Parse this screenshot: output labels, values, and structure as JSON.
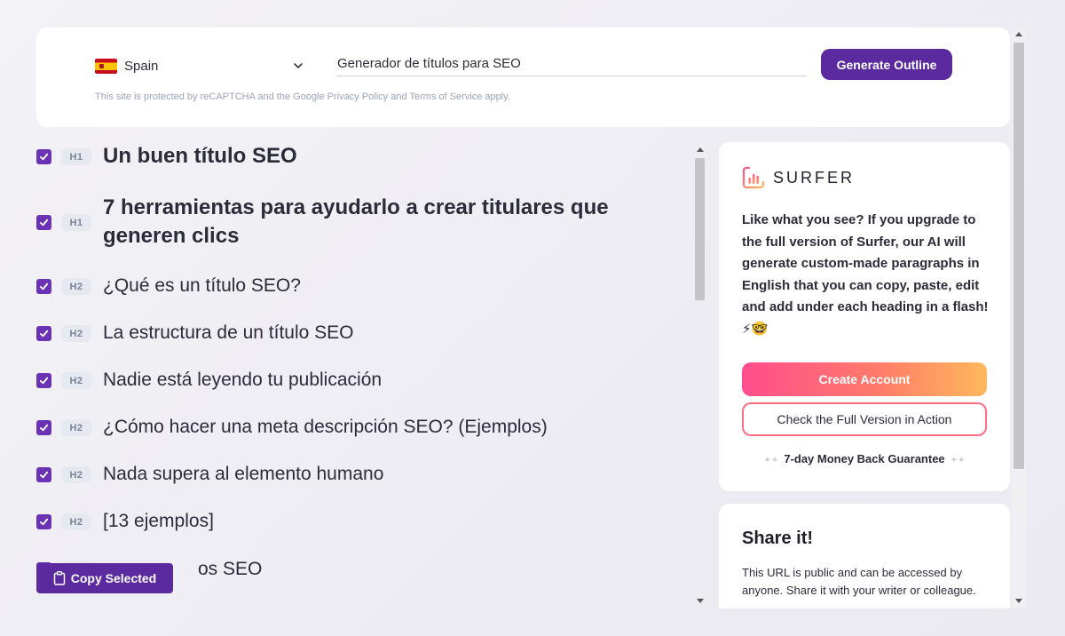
{
  "search": {
    "country": "Spain",
    "topic_value": "Generador de títulos para SEO",
    "generate_label": "Generate Outline",
    "recaptcha_notice": "This site is protected by reCAPTCHA and the Google Privacy Policy and Terms of Service apply."
  },
  "outline": {
    "items": [
      {
        "level": "H1",
        "text": "Un buen título SEO",
        "checked": true
      },
      {
        "level": "H1",
        "text": "7 herramientas para ayudarlo a crear titulares que generen clics",
        "checked": true
      },
      {
        "level": "H2",
        "text": "¿Qué es un título SEO?",
        "checked": true
      },
      {
        "level": "H2",
        "text": "La estructura de un título SEO",
        "checked": true
      },
      {
        "level": "H2",
        "text": "Nadie está leyendo tu publicación",
        "checked": true
      },
      {
        "level": "H2",
        "text": "¿Cómo hacer una meta descripción SEO? (Ejemplos)",
        "checked": true
      },
      {
        "level": "H2",
        "text": "Nada supera al elemento humano",
        "checked": true
      },
      {
        "level": "H2",
        "text": "[13 ejemplos]",
        "checked": true
      },
      {
        "level": "H2",
        "text": "os SEO",
        "checked": true
      }
    ],
    "copy_label": "Copy Selected"
  },
  "surfer": {
    "logo_text": "SURFER",
    "promo": "Like what you see? If you upgrade to the full version of Surfer, our AI will generate custom-made paragraphs in English that you can copy, paste, edit and add under each heading in a flash! ⚡🤓",
    "create_label": "Create Account",
    "check_label": "Check the Full Version in Action",
    "guarantee": "7-day Money Back Guarantee"
  },
  "share": {
    "title": "Share it!",
    "text": "This URL is public and can be accessed by anyone. Share it with your writer or colleague."
  },
  "colors": {
    "brand_purple": "#5b2a9f",
    "checkbox_purple": "#6b33b3",
    "gradient_start": "#ff4d8d",
    "gradient_end": "#ffb85c"
  }
}
